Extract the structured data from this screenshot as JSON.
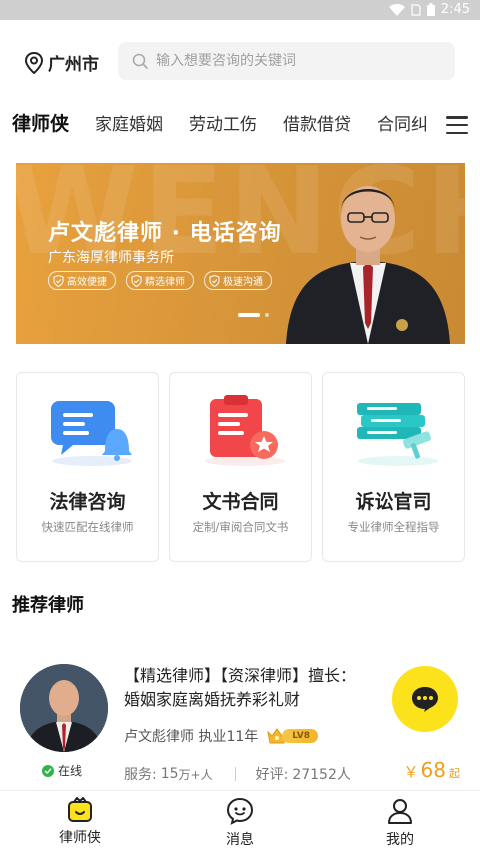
{
  "status_bar": {
    "time": "2:45"
  },
  "header": {
    "city": "广州市",
    "search_placeholder": "输入想要咨询的关键词"
  },
  "tabs": {
    "items": [
      "律师侠",
      "家庭婚姻",
      "劳动工伤",
      "借款借贷",
      "合同纠"
    ],
    "active_index": 0
  },
  "banner": {
    "bg_text": "WENCH",
    "title": "卢文彪律师 · 电话咨询",
    "subtitle": "广东海厚律师事务所",
    "tags": [
      "高效便捷",
      "精选律师",
      "极速沟通"
    ],
    "page_count": 2,
    "current_page": 0
  },
  "services": [
    {
      "title": "法律咨询",
      "subtitle": "快速匹配在线律师",
      "icon": "chat-bubble-bell-icon"
    },
    {
      "title": "文书合同",
      "subtitle": "定制/审阅合同文书",
      "icon": "document-star-icon"
    },
    {
      "title": "诉讼官司",
      "subtitle": "专业律师全程指导",
      "icon": "gavel-book-icon"
    }
  ],
  "section": {
    "title": "推荐律师"
  },
  "lawyer": {
    "description": "【精选律师】【资深律师】擅长：婚姻家庭离婚抚养彩礼财",
    "name_line": "卢文彪律师 执业11年",
    "level": "LV8",
    "online": "在线",
    "service_label": "服务:",
    "service_value": "15",
    "service_unit": "万+人",
    "rating_label": "好评:",
    "rating_value": "27152人",
    "price_currency": "￥",
    "price_value": "68",
    "price_unit": "起"
  },
  "bottom_nav": [
    {
      "label": "律师侠",
      "icon": "home-lawyer-icon"
    },
    {
      "label": "消息",
      "icon": "message-icon"
    },
    {
      "label": "我的",
      "icon": "profile-icon"
    }
  ],
  "colors": {
    "accent_yellow": "#F8DE1E",
    "banner_orange": "#D9963A",
    "price_orange": "#F39C1E",
    "online_green": "#2FB44A"
  }
}
